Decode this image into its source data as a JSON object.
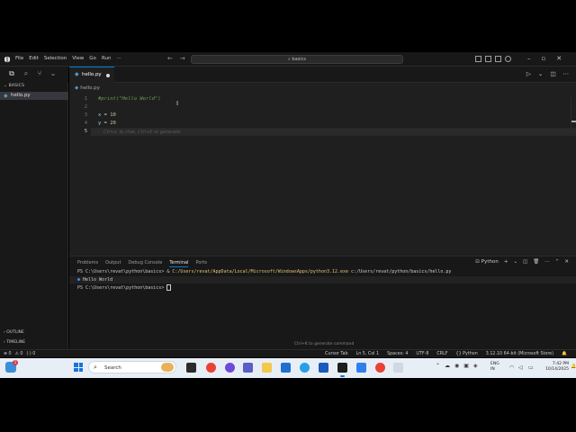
{
  "titlebar": {
    "menu": [
      "File",
      "Edit",
      "Selection",
      "View",
      "Go",
      "Run",
      "···"
    ],
    "command_center": "basics"
  },
  "sidebar": {
    "section": "BASICS",
    "file": "hello.py",
    "outline": "OUTLINE",
    "timeline": "TIMELINE"
  },
  "editor": {
    "tab_label": "hello.py",
    "breadcrumb": "hello.py",
    "line_numbers": [
      "1",
      "2",
      "3",
      "4",
      "5"
    ],
    "lines": {
      "l1": "#print(\"Hello World\")",
      "l3_var": "x",
      "l3_op": " = ",
      "l3_val": "10",
      "l4_var": "y",
      "l4_op": " = ",
      "l4_val": "20"
    },
    "inline_hint": "Ctrl+L to chat, Ctrl+K to generate"
  },
  "panel": {
    "tabs": [
      "Problems",
      "Output",
      "Debug Console",
      "Terminal",
      "Ports"
    ],
    "active_tab": "Terminal",
    "terminal_name": "Python",
    "lines": {
      "cmd_prompt": "PS C:\\Users\\revat\\python\\basics> ",
      "cmd_amp": "& ",
      "cmd_exe": "C:/Users/revat/AppData/Local/Microsoft/WindowsApps/python3.12.exe",
      "cmd_script": " c:/Users/revat/python/basics/hello.py",
      "output": "Hello World",
      "prompt": "PS C:\\Users\\revat\\python\\basics> "
    },
    "hint": "Ctrl+K to generate command"
  },
  "statusbar": {
    "left": [
      "⊗ 0",
      "⚠ 0",
      "(·) 0"
    ],
    "right": [
      "Cursor Tab",
      "Ln 5, Col 1",
      "Spaces: 4",
      "UTF-8",
      "CRLF",
      "{} Python",
      "3.12.10 64-bit (Microsoft Store)",
      "🔔"
    ]
  },
  "taskbar": {
    "weather_badge": "1",
    "search_label": "Search",
    "language": [
      "ENG",
      "IN"
    ],
    "time": "7:42 PM",
    "date": "10/14/2025"
  },
  "colors": {
    "accent": "#0078d4",
    "python_icon": "#519aba",
    "comment": "#6a9955",
    "variable": "#9cdcfe",
    "number": "#b5cea8"
  }
}
